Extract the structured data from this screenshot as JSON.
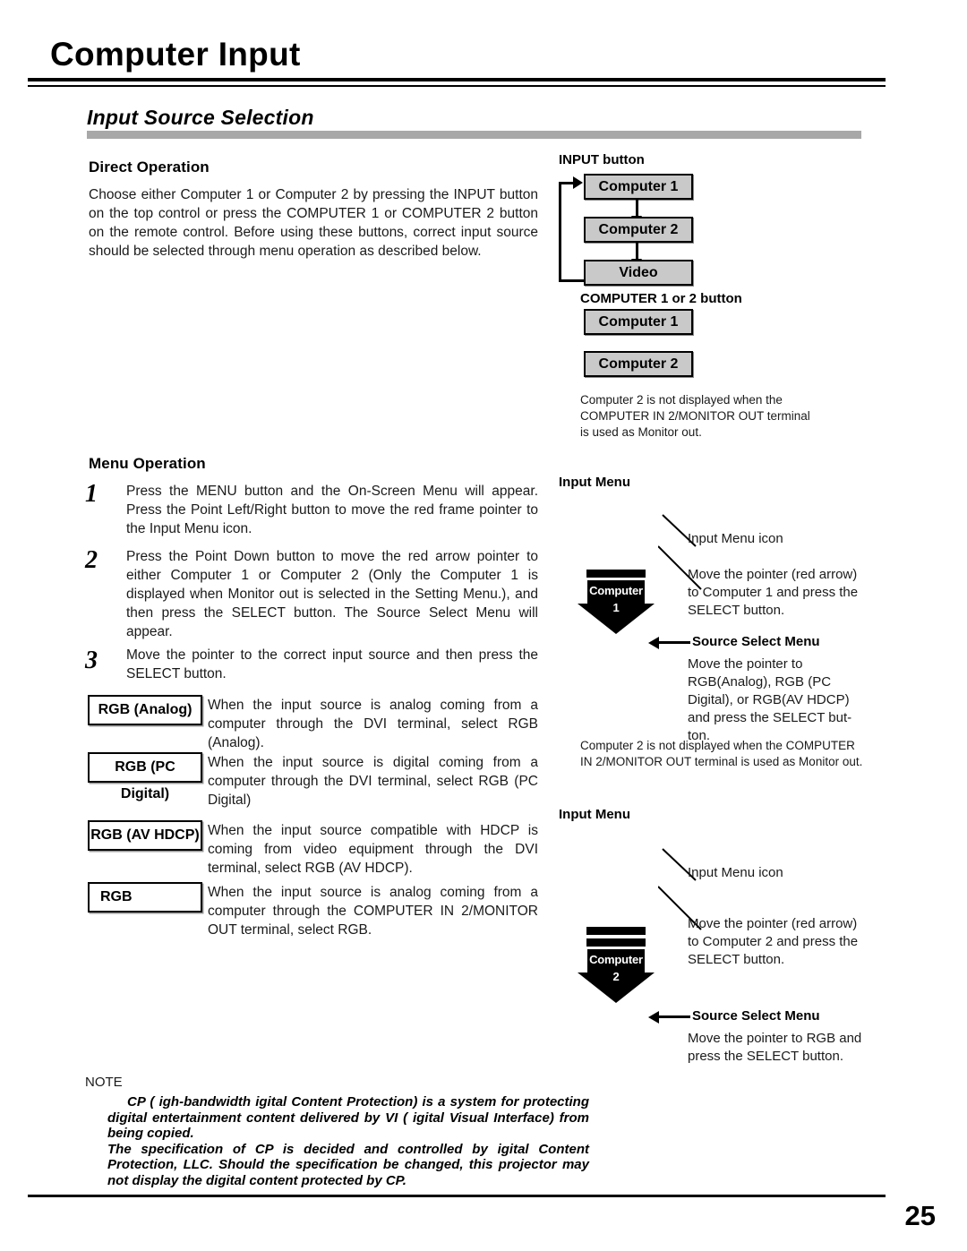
{
  "page": {
    "title": "Computer Input",
    "section_heading": "Input Source Selection",
    "number": "25"
  },
  "direct_operation": {
    "heading": "Direct Operation",
    "paragraph": "Choose either Computer 1 or Computer 2 by pressing the INPUT button on the top control or press the COMPUTER 1 or COMPUTER 2 button on the remote control. Before using these buttons, correct input source should be selected through menu operation as described below."
  },
  "input_button_diagram": {
    "heading": "INPUT button",
    "boxes": [
      {
        "label": "Computer 1"
      },
      {
        "label": "Computer 2"
      },
      {
        "label": "Video"
      }
    ]
  },
  "computer_button_diagram": {
    "heading": "COMPUTER 1 or 2 button",
    "boxes": [
      {
        "label": "Computer 1"
      },
      {
        "label": "Computer 2"
      }
    ],
    "note": "Computer 2 is not displayed when the COMPUTER IN 2/MONITOR OUT terminal is used as Monitor out."
  },
  "menu_operation": {
    "heading": "Menu Operation",
    "steps": [
      {
        "number": "1",
        "text": "Press the MENU button and the On-Screen Menu will appear. Press the Point Left/Right button to move the red frame pointer to the Input Menu icon."
      },
      {
        "number": "2",
        "text": "Press the Point Down button to move the red arrow pointer to either Computer 1 or Computer 2 (Only the Computer 1 is displayed when Monitor out is selected in the Setting Menu.), and then press the SELECT button. The Source Select Menu will appear."
      },
      {
        "number": "3",
        "text": "Move the pointer to the correct input source and then press the SELECT button."
      }
    ],
    "definitions": [
      {
        "term": "RGB (Analog)",
        "text": "When the input source is analog coming from a computer through the DVI terminal, select RGB (Analog)."
      },
      {
        "term": "RGB (PC Digital)",
        "text": "When the input source is digital coming from a computer through the DVI terminal, select RGB (PC Digital)"
      },
      {
        "term": "RGB (AV HDCP)",
        "text": "When the input source compatible with HDCP is coming from video equipment through the DVI terminal, select RGB (AV HDCP)."
      },
      {
        "term": "RGB",
        "text": "When the input source is analog coming from a computer through the COMPUTER IN 2/MONITOR OUT terminal, select RGB."
      }
    ]
  },
  "input_menu_1": {
    "heading": "Input Menu",
    "icon_label": "Computer",
    "icon_number": "1",
    "callout_icon": "Input Menu icon",
    "callout_move": "Move the pointer (red arrow) to Computer 1 and press the SELECT button.",
    "source_select_label": "Source Select Menu",
    "source_select_text": "Move the pointer to RGB(Analog), RGB (PC Digital), or RGB(AV HDCP) and press the SELECT but-ton.",
    "note": "Computer 2 is not displayed when the COMPUTER IN 2/MONITOR OUT terminal is used as Monitor out."
  },
  "input_menu_2": {
    "heading": "Input Menu",
    "icon_label": "Computer",
    "icon_number": "2",
    "callout_icon": "Input Menu icon",
    "callout_move": "Move the pointer (red arrow) to Computer 2 and press the SELECT button.",
    "source_select_label": "Source Select Menu",
    "source_select_text": "Move the pointer to RGB and press the SELECT button."
  },
  "note": {
    "title": "NOTE",
    "paragraph_1": "CP ( igh-bandwidth  igital Content Protection) is a system for protecting digital entertainment content delivered by  VI ( igital Visual Interface) from being copied.",
    "paragraph_2": "The specification of   CP is decided and controlled by  igital Content Protection, LLC. Should the specification be changed, this projector may not display the digital content protected by   CP."
  },
  "colors": {
    "flow_box_fill": "#c9c9c9",
    "section_bar": "#a8a8a8",
    "ink": "#000000"
  }
}
